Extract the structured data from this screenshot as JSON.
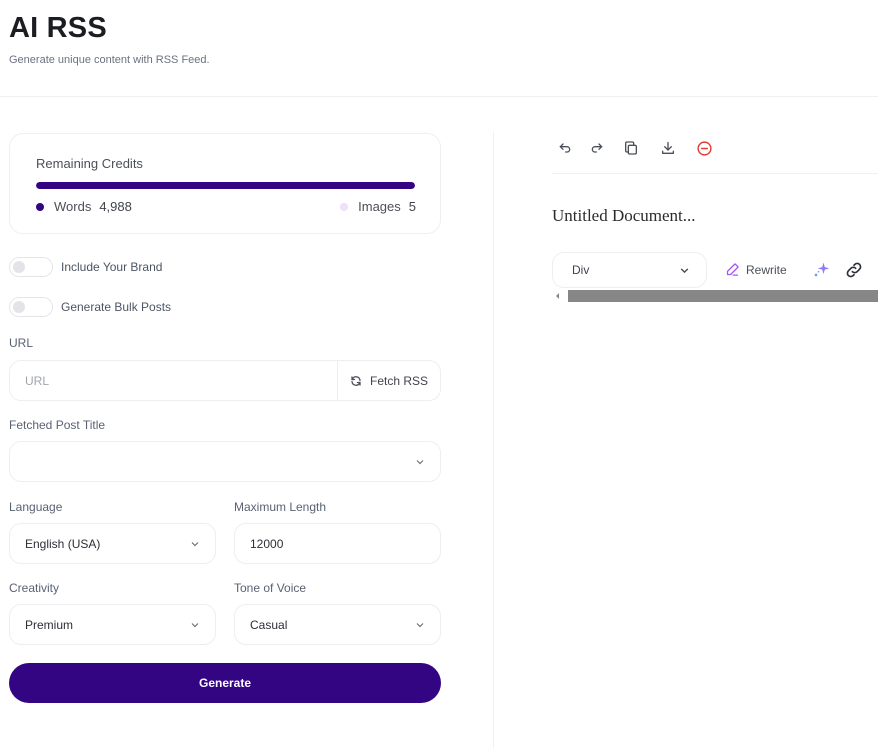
{
  "header": {
    "title": "AI RSS",
    "subtitle": "Generate unique content with RSS Feed."
  },
  "credits": {
    "title": "Remaining Credits",
    "words_label": "Words",
    "words_value": "4,988",
    "images_label": "Images",
    "images_value": "5",
    "words_share_percent": 100,
    "colors": {
      "words": "#330582",
      "images": "#efe0fb"
    }
  },
  "toggles": [
    {
      "label": "Include Your Brand",
      "checked": false
    },
    {
      "label": "Generate Bulk Posts",
      "checked": false
    }
  ],
  "url": {
    "label": "URL",
    "placeholder": "URL",
    "value": "",
    "fetch_label": "Fetch RSS",
    "fetch_icon": "refresh-icon"
  },
  "fetched_post": {
    "label": "Fetched Post Title",
    "selected": ""
  },
  "language": {
    "label": "Language",
    "selected": "English (USA)"
  },
  "max_length": {
    "label": "Maximum Length",
    "value": "12000"
  },
  "creativity": {
    "label": "Creativity",
    "selected": "Premium"
  },
  "tone": {
    "label": "Tone of Voice",
    "selected": "Casual"
  },
  "generate": {
    "label": "Generate",
    "color": "#330582"
  },
  "editor": {
    "toolbar": [
      {
        "name": "undo-icon"
      },
      {
        "name": "redo-icon"
      },
      {
        "name": "copy-icon"
      },
      {
        "name": "download-icon"
      },
      {
        "name": "delete-icon",
        "color": "#e53935"
      }
    ],
    "doc_title": "Untitled Document...",
    "block_type": "Div",
    "rewrite_label": "Rewrite"
  }
}
